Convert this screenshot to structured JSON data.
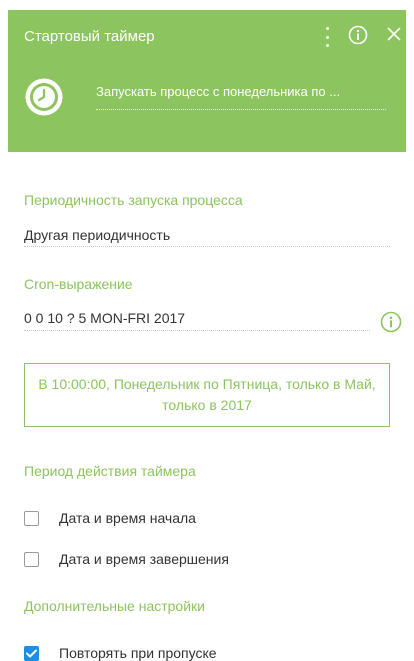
{
  "header": {
    "title": "Стартовый таймер",
    "description": "Запускать процесс с понедельника по ...",
    "menu_icon": "more-vertical-icon",
    "info_icon": "info-icon",
    "close_icon": "close-icon",
    "element_icon": "clock-icon"
  },
  "periodicity": {
    "label": "Периодичность запуска процесса",
    "value": "Другая периодичность"
  },
  "cron": {
    "label": "Cron-выражение",
    "value": "0 0 10 ? 5 MON-FRI 2017",
    "info_icon": "info-icon"
  },
  "summary": {
    "text": "В 10:00:00, Понедельник по Пятница, только в Май, только в 2017"
  },
  "timer_period": {
    "label": "Период действия таймера",
    "start_label": "Дата и время начала",
    "start_checked": false,
    "end_label": "Дата и время завершения",
    "end_checked": false
  },
  "additional": {
    "label": "Дополнительные настройки",
    "repeat_label": "Повторять при пропуске",
    "repeat_checked": true
  },
  "colors": {
    "accent": "#8cc45f",
    "checkbox_checked": "#1b8ee5",
    "text": "#333333"
  }
}
